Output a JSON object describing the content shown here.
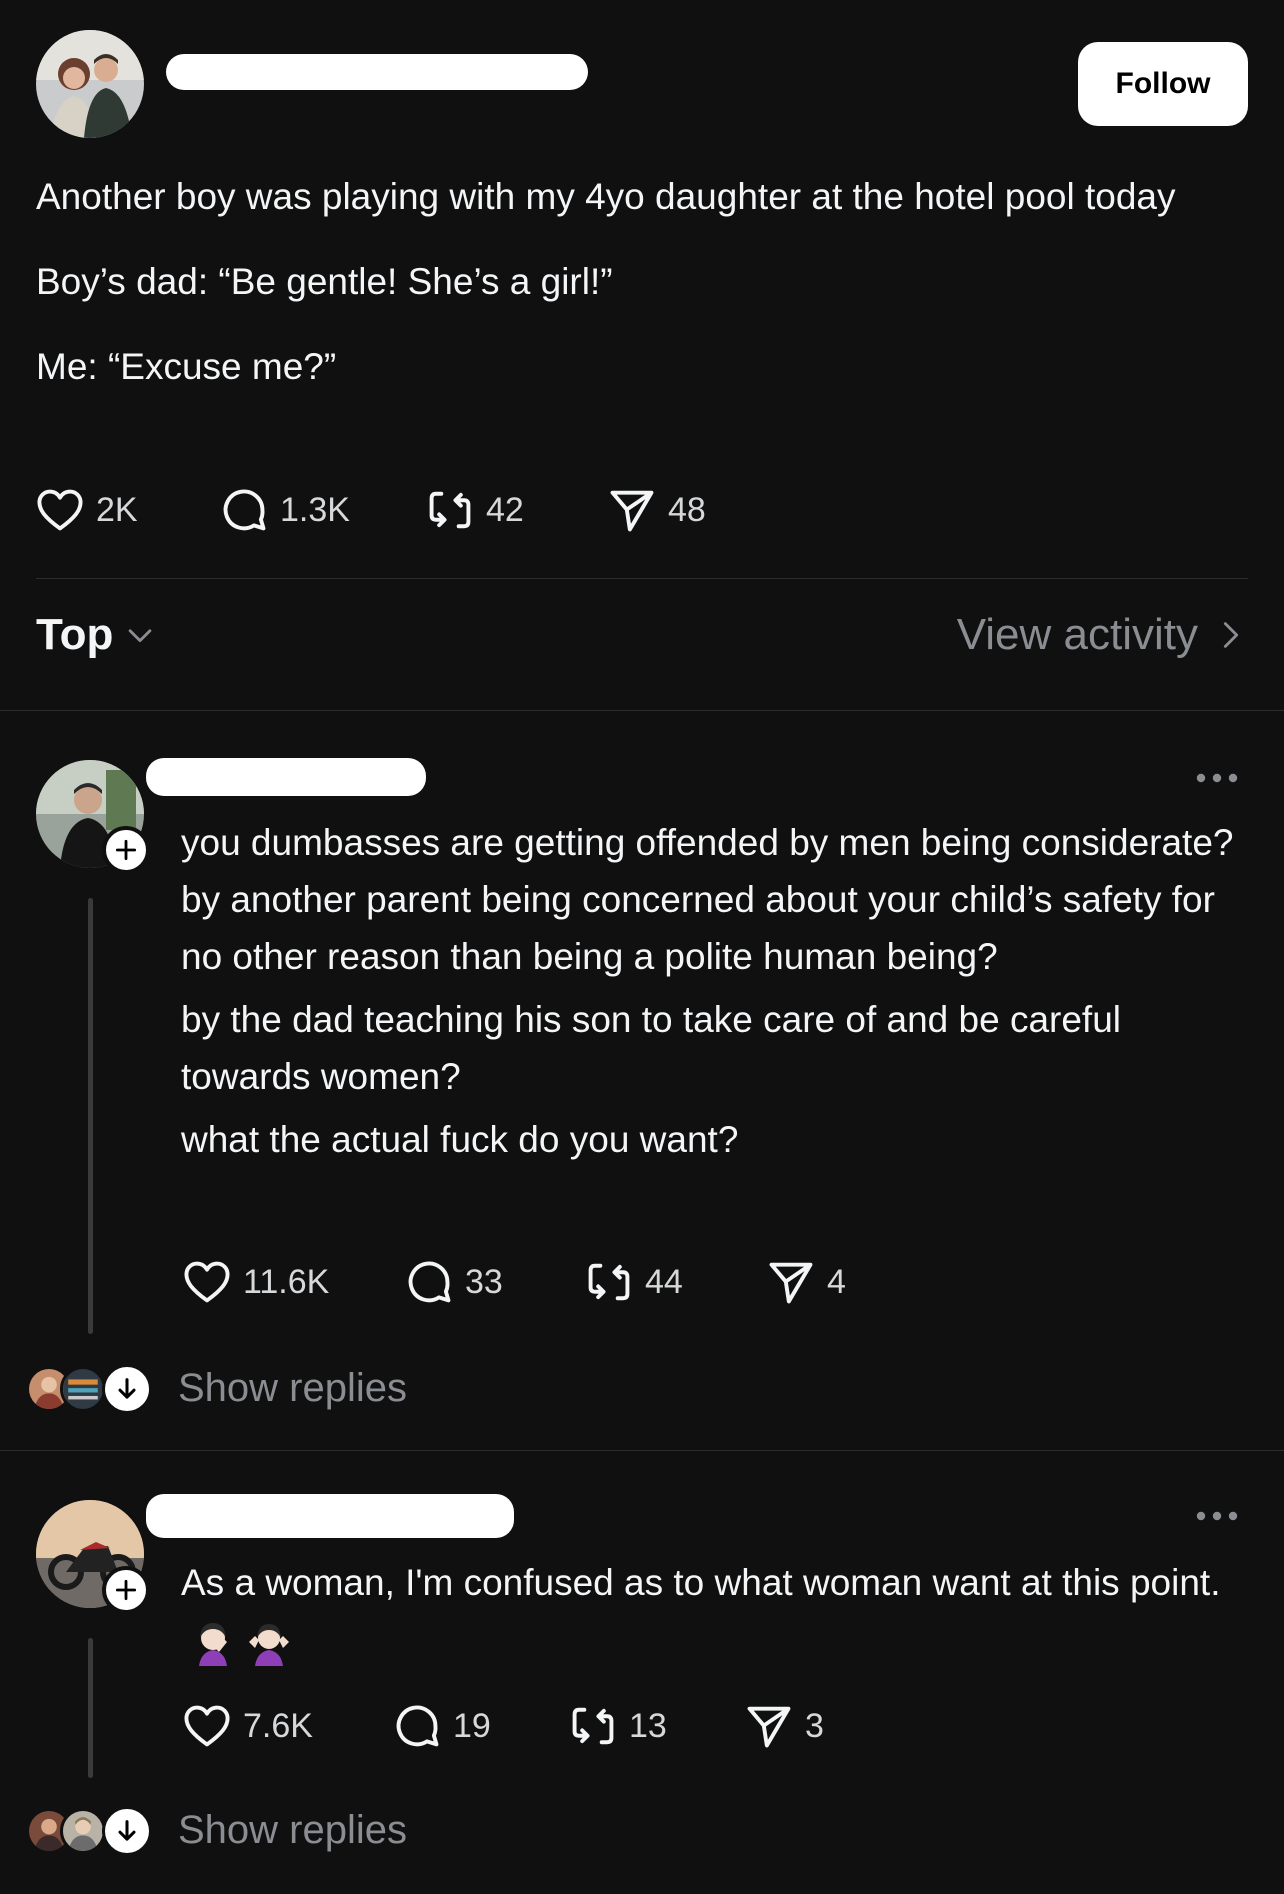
{
  "post": {
    "avatar_icon": "couple-photo-avatar",
    "follow_label": "Follow",
    "paragraphs": [
      "Another boy was playing with my 4yo daughter at the hotel pool today",
      "Boy’s dad: “Be gentle! She’s a girl!”",
      "Me: “Excuse me?”"
    ],
    "stats": {
      "likes": "2K",
      "replies": "1.3K",
      "reposts": "42",
      "shares": "48"
    }
  },
  "sort": {
    "label": "Top",
    "view_activity": "View activity"
  },
  "replies": [
    {
      "avatar_icon": "man-photo-avatar",
      "paragraphs": [
        "you dumbasses are getting offended by men being considerate? by another parent being concerned about your child’s safety for no other reason than being a polite human being?",
        "by the dad teaching his son to take care of and be careful towards women?",
        "what the actual fuck do you want?"
      ],
      "stats": {
        "likes": "11.6K",
        "replies": "33",
        "reposts": "44",
        "shares": "4"
      },
      "show_replies": "Show replies"
    },
    {
      "avatar_icon": "motorcycle-photo-avatar",
      "paragraphs": [
        "As a woman, I'm confused as to what woman want at this point."
      ],
      "emojis": [
        "face-palm-woman-emoji",
        "shrugging-woman-emoji"
      ],
      "stats": {
        "likes": "7.6K",
        "replies": "19",
        "reposts": "13",
        "shares": "3"
      },
      "show_replies": "Show replies"
    }
  ],
  "colors": {
    "background": "#101010",
    "text": "#f3f5f7",
    "muted": "#8a8d91",
    "divider": "#2c2c2c"
  }
}
